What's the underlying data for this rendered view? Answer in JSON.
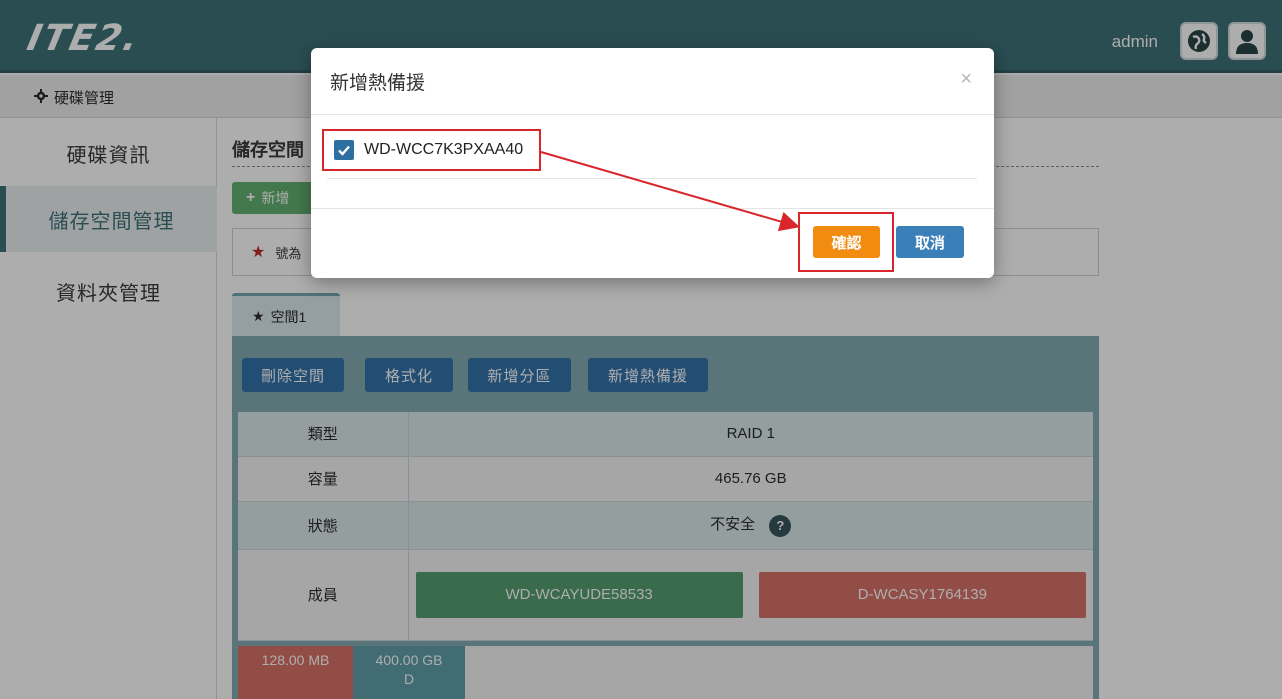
{
  "header": {
    "logo": "ITE2.",
    "user": "admin",
    "globe_icon": "globe-icon",
    "user_icon": "user-icon"
  },
  "breadcrumb": {
    "icon": "gear-icon",
    "label": "硬碟管理"
  },
  "sidebar": {
    "items": [
      {
        "label": "硬碟資訊",
        "active": false
      },
      {
        "label": "儲存空間管理",
        "active": true
      },
      {
        "label": "資料夾管理",
        "active": false
      }
    ]
  },
  "main": {
    "title": "儲存空間",
    "add_button": "新增",
    "note": "號為",
    "tab_label": "空間1",
    "actions": [
      "刪除空間",
      "格式化",
      "新增分區",
      "新增熱備援"
    ],
    "rows": {
      "type_label": "類型",
      "type_value": "RAID 1",
      "capacity_label": "容量",
      "capacity_value": "465.76 GB",
      "status_label": "狀態",
      "status_value": "不安全",
      "members_label": "成員"
    },
    "members": [
      {
        "name": "WD-WCAYUDE58533",
        "color": "#4e9a6b"
      },
      {
        "name": "D-WCASY1764139",
        "color": "#d76c63"
      }
    ],
    "usage": [
      {
        "line1": "128.00 MB",
        "line2": "",
        "color": "#d76c63"
      },
      {
        "line1": "400.00 GB",
        "line2": "D",
        "color": "#5b9ba6"
      }
    ]
  },
  "modal": {
    "title": "新增熱備援",
    "close": "×",
    "disk": "WD-WCC7K3PXAA40",
    "disk_checked": true,
    "confirm": "確認",
    "cancel": "取消"
  },
  "colors": {
    "header": "#366c73",
    "annotation": "#d8262c",
    "confirm": "#f28c10",
    "cancel": "#3a7fb8"
  }
}
